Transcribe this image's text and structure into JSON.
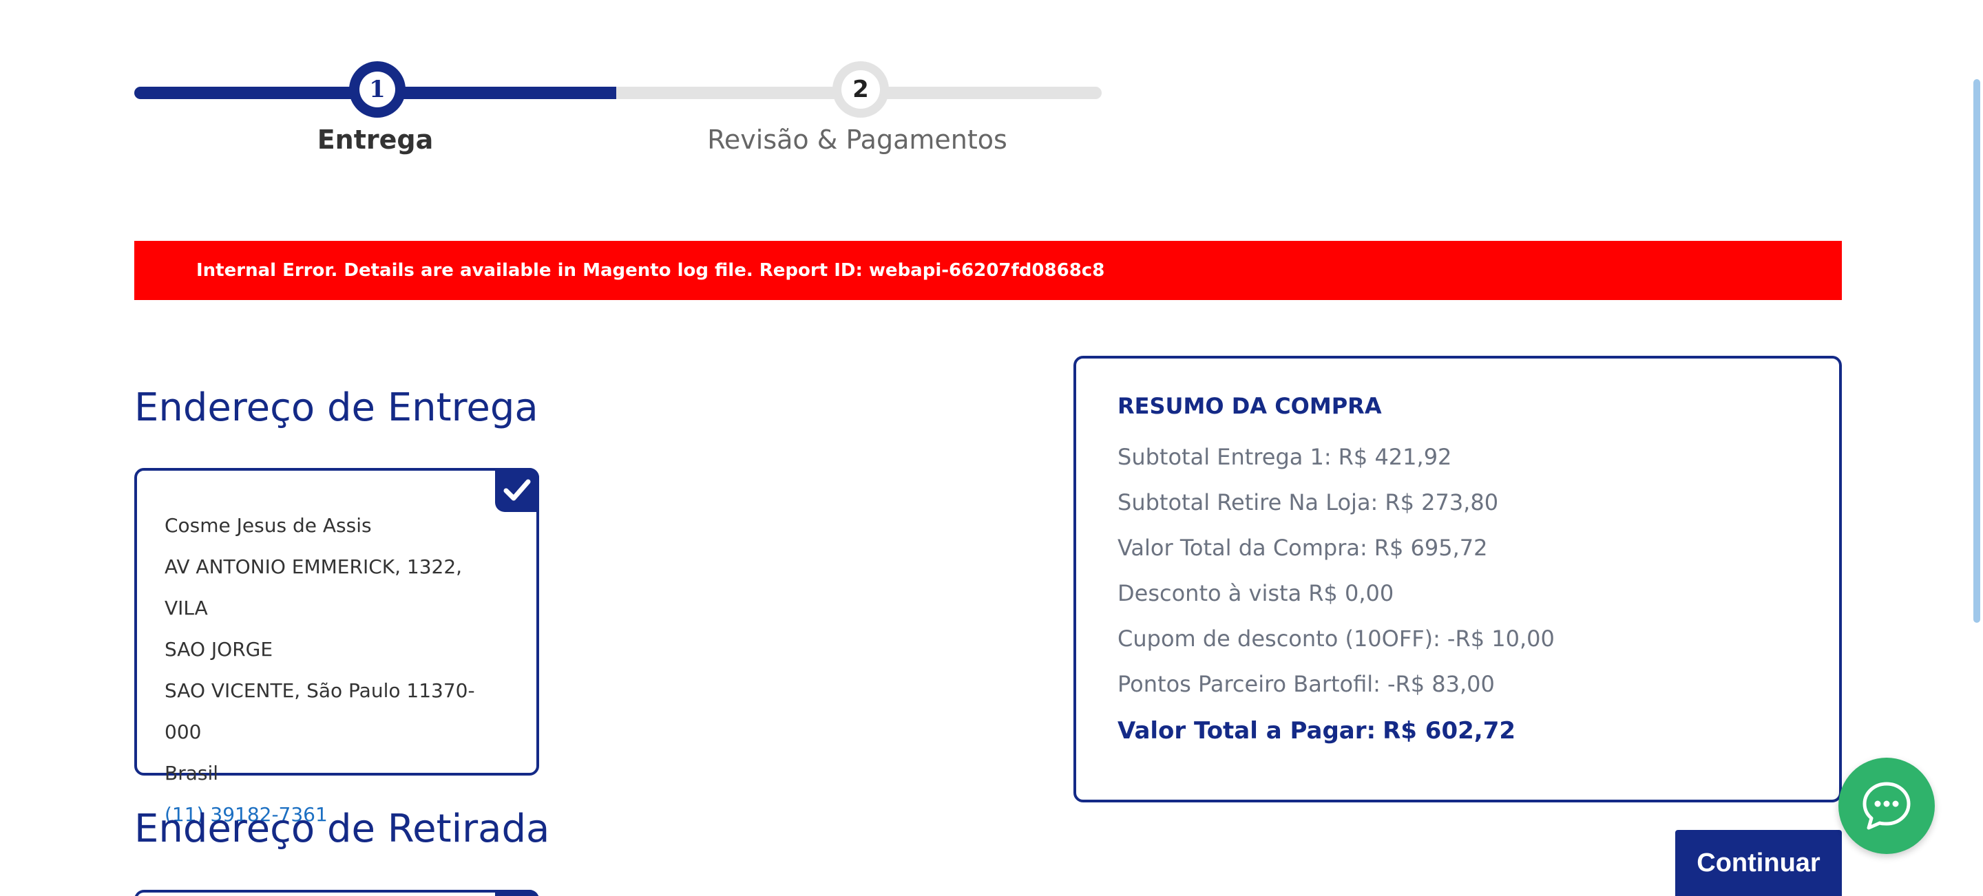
{
  "progress": {
    "steps": [
      {
        "number": "1",
        "label": "Entrega"
      },
      {
        "number": "2",
        "label": "Revisão & Pagamentos"
      }
    ]
  },
  "error": {
    "message": "Internal Error. Details are available in Magento log file. Report ID: webapi-66207fd0868c8"
  },
  "delivery": {
    "title": "Endereço de Entrega",
    "address": {
      "name": "Cosme Jesus de Assis",
      "street": "AV ANTONIO EMMERICK, 1322, VILA",
      "street2": "SAO JORGE",
      "city": "SAO VICENTE, São Paulo 11370-000",
      "country": "Brasil",
      "phone": "(11) 39182-7361"
    }
  },
  "pickup": {
    "title": "Endereço de Retirada"
  },
  "summary": {
    "title": "RESUMO DA COMPRA",
    "rows": [
      {
        "label": "Subtotal Entrega 1:",
        "value": "R$ 421,92"
      },
      {
        "label": "Subtotal Retire Na Loja:",
        "value": "R$ 273,80"
      },
      {
        "label": "Valor Total da Compra:",
        "value": "R$ 695,72"
      },
      {
        "label": "Desconto à vista",
        "value": "R$ 0,00"
      },
      {
        "label": "Cupom de desconto (10OFF):",
        "value": "-R$ 10,00"
      },
      {
        "label": "Pontos Parceiro Bartofil:",
        "value": "-R$ 83,00"
      }
    ],
    "total": {
      "label": "Valor Total a Pagar:",
      "value": "R$ 602,72"
    }
  },
  "actions": {
    "continue_label": "Continuar"
  },
  "icons": {
    "check": "checkmark-icon",
    "chat": "chat-bubble-icon"
  },
  "colors": {
    "brand": "#142a87",
    "error": "#ff0000",
    "chat": "#2fb36b"
  }
}
